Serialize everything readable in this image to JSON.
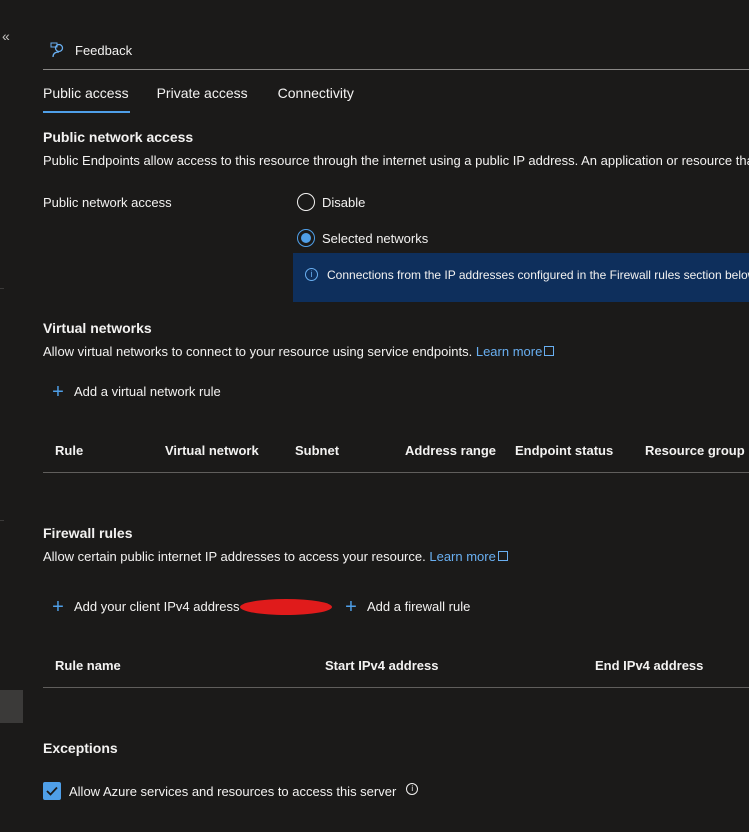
{
  "toolbar": {
    "feedback_label": "Feedback"
  },
  "tabs": [
    {
      "label": "Public access",
      "active": true
    },
    {
      "label": "Private access",
      "active": false
    },
    {
      "label": "Connectivity",
      "active": false
    }
  ],
  "public_network": {
    "heading": "Public network access",
    "description": "Public Endpoints allow access to this resource through the internet using a public IP address. An application or resource that",
    "field_label": "Public network access",
    "options": [
      {
        "label": "Disable",
        "selected": false
      },
      {
        "label": "Selected networks",
        "selected": true
      }
    ],
    "info_text": "Connections from the IP addresses configured in the Firewall rules section below"
  },
  "virtual_networks": {
    "heading": "Virtual networks",
    "description": "Allow virtual networks to connect to your resource using service endpoints.",
    "learn_more": "Learn more",
    "add_label": "Add a virtual network rule",
    "columns": [
      "Rule",
      "Virtual network",
      "Subnet",
      "Address range",
      "Endpoint status",
      "Resource group"
    ]
  },
  "firewall_rules": {
    "heading": "Firewall rules",
    "description": "Allow certain public internet IP addresses to access your resource.",
    "learn_more": "Learn more",
    "add_client_label": "Add your client IPv4 address",
    "add_rule_label": "Add a firewall rule",
    "columns": [
      "Rule name",
      "Start IPv4 address",
      "End IPv4 address"
    ]
  },
  "exceptions": {
    "heading": "Exceptions",
    "allow_azure_label": "Allow Azure services and resources to access this server",
    "allow_azure_checked": true
  },
  "colors": {
    "accent": "#4f9fe8",
    "link": "#69aff1",
    "info_bg": "#0e2f5c",
    "bg": "#1b1a19"
  }
}
